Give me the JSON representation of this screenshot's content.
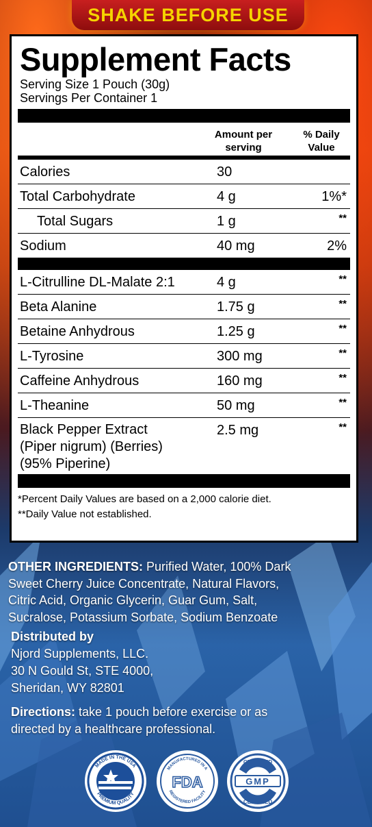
{
  "banner": "SHAKE BEFORE USE",
  "facts": {
    "title": "Supplement Facts",
    "serving_size": "Serving Size 1 Pouch (30g)",
    "servings_per_container": "Servings Per Container 1",
    "col_amount": "Amount per serving",
    "col_dv": "% Daily Value",
    "rows_a": [
      {
        "name": "Calories",
        "amount": "30",
        "dv": ""
      },
      {
        "name": "Total Carbohydrate",
        "amount": "4 g",
        "dv": "1%*"
      },
      {
        "name": "Total Sugars",
        "amount": "1 g",
        "dv": "**"
      },
      {
        "name": "Sodium",
        "amount": "40 mg",
        "dv": "2%"
      }
    ],
    "rows_b": [
      {
        "name": "L-Citrulline DL-Malate 2:1",
        "amount": "4 g",
        "dv": "**"
      },
      {
        "name": "Beta Alanine",
        "amount": "1.75 g",
        "dv": "**"
      },
      {
        "name": "Betaine Anhydrous",
        "amount": "1.25 g",
        "dv": "**"
      },
      {
        "name": "L-Tyrosine",
        "amount": "300 mg",
        "dv": "**"
      },
      {
        "name": "Caffeine Anhydrous",
        "amount": "160 mg",
        "dv": "**"
      },
      {
        "name": "L-Theanine",
        "amount": "50 mg",
        "dv": "**"
      },
      {
        "name": "Black Pepper Extract (Piper nigrum) (Berries) (95% Piperine)",
        "name_l1": "Black Pepper Extract",
        "name_l2": "(Piper nigrum) (Berries)",
        "name_l3": "(95% Piperine)",
        "amount": "2.5 mg",
        "dv": "**"
      }
    ],
    "footnote1": "*Percent Daily Values are based on a 2,000 calorie diet.",
    "footnote2": "**Daily Value not established."
  },
  "other_ingredients": {
    "label": "OTHER INGREDIENTS:",
    "l1": " Purified Water, 100% Dark",
    "l2": "Sweet Cherry Juice Concentrate, Natural Flavors,",
    "l3": "Citric Acid, Organic Glycerin, Guar Gum, Salt,",
    "l4": "Sucralose, Potassium Sorbate, Sodium Benzoate"
  },
  "distributor": {
    "title": "Distributed by",
    "name": "Njord Supplements, LLC.",
    "address1": "30 N Gould St, STE 4000,",
    "address2": "Sheridan, WY 82801"
  },
  "directions": {
    "label": "Directions:",
    "l1": " take 1 pouch before exercise or as",
    "l2": "directed by a healthcare professional."
  },
  "badges": {
    "usa_top": "MADE IN THE USA",
    "usa_bottom": "PREMIUM QUALITY",
    "fda_top": "MANUFACTURED IN A",
    "fda_mid": "FDA",
    "fda_bottom": "REGISTERED FACILITY",
    "gmp_top": "CERTIFIED",
    "gmp_mid": "GMP",
    "gmp_bottom": "CERTIFIED"
  }
}
